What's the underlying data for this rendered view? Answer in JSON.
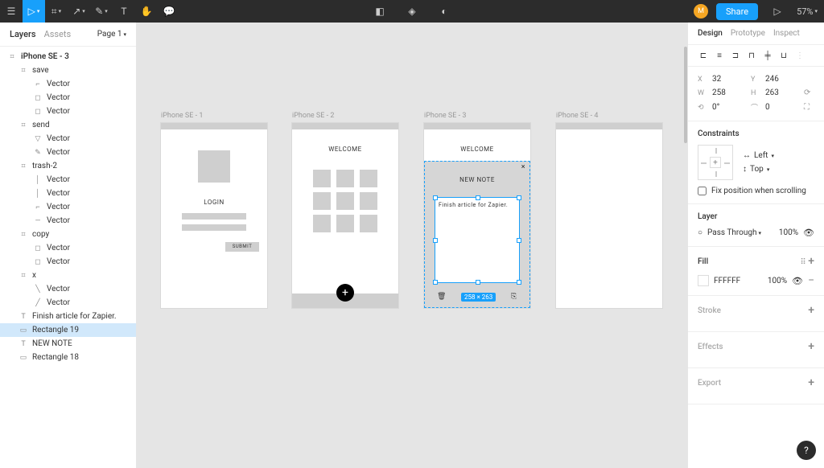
{
  "toolbar": {
    "share": "Share",
    "zoom": "57%",
    "avatar_initial": "M"
  },
  "left_panel": {
    "tabs": {
      "layers": "Layers",
      "assets": "Assets"
    },
    "page": "Page 1",
    "tree": [
      {
        "indent": 0,
        "icon": "⌗",
        "name": "iPhone SE - 3",
        "bold": true
      },
      {
        "indent": 1,
        "icon": "⌗",
        "name": "save"
      },
      {
        "indent": 2,
        "icon": "⌐",
        "name": "Vector"
      },
      {
        "indent": 2,
        "icon": "◻",
        "name": "Vector"
      },
      {
        "indent": 2,
        "icon": "◻",
        "name": "Vector"
      },
      {
        "indent": 1,
        "icon": "⌗",
        "name": "send"
      },
      {
        "indent": 2,
        "icon": "▽",
        "name": "Vector"
      },
      {
        "indent": 2,
        "icon": "✎",
        "name": "Vector"
      },
      {
        "indent": 1,
        "icon": "⌗",
        "name": "trash-2"
      },
      {
        "indent": 2,
        "icon": "│",
        "name": "Vector"
      },
      {
        "indent": 2,
        "icon": "│",
        "name": "Vector"
      },
      {
        "indent": 2,
        "icon": "⌐",
        "name": "Vector"
      },
      {
        "indent": 2,
        "icon": "—",
        "name": "Vector"
      },
      {
        "indent": 1,
        "icon": "⌗",
        "name": "copy"
      },
      {
        "indent": 2,
        "icon": "◻",
        "name": "Vector"
      },
      {
        "indent": 2,
        "icon": "◻",
        "name": "Vector"
      },
      {
        "indent": 1,
        "icon": "⌗",
        "name": "x"
      },
      {
        "indent": 2,
        "icon": "╲",
        "name": "Vector"
      },
      {
        "indent": 2,
        "icon": "╱",
        "name": "Vector"
      },
      {
        "indent": 1,
        "icon": "T",
        "name": "Finish article for Zapier."
      },
      {
        "indent": 1,
        "icon": "▭",
        "name": "Rectangle 19",
        "selected": true
      },
      {
        "indent": 1,
        "icon": "T",
        "name": "NEW NOTE"
      },
      {
        "indent": 1,
        "icon": "▭",
        "name": "Rectangle 18"
      }
    ]
  },
  "frames": {
    "f1": {
      "label": "iPhone SE - 1",
      "login": "LOGIN",
      "submit": "SUBMIT"
    },
    "f2": {
      "label": "iPhone SE - 2",
      "welcome": "WELCOME"
    },
    "f3": {
      "label": "iPhone SE - 3",
      "welcome": "WELCOME",
      "new_note": "NEW NOTE",
      "note_text": "Finish article for Zapier.",
      "dims": "258 × 263"
    },
    "f4": {
      "label": "iPhone SE - 4"
    }
  },
  "right_panel": {
    "tabs": {
      "design": "Design",
      "prototype": "Prototype",
      "inspect": "Inspect"
    },
    "props": {
      "x_lbl": "X",
      "x": "32",
      "y_lbl": "Y",
      "y": "246",
      "w_lbl": "W",
      "w": "258",
      "h_lbl": "H",
      "h": "263",
      "r_lbl": "⟲",
      "r": "0°",
      "c_lbl": "⌒",
      "c": "0"
    },
    "constraints": {
      "title": "Constraints",
      "horizontal": "Left",
      "vertical": "Top",
      "fix": "Fix position when scrolling"
    },
    "layer": {
      "title": "Layer",
      "blend": "Pass Through",
      "opacity": "100%"
    },
    "fill": {
      "title": "Fill",
      "hex": "FFFFFF",
      "opacity": "100%"
    },
    "stroke": "Stroke",
    "effects": "Effects",
    "export": "Export"
  },
  "help": "?"
}
